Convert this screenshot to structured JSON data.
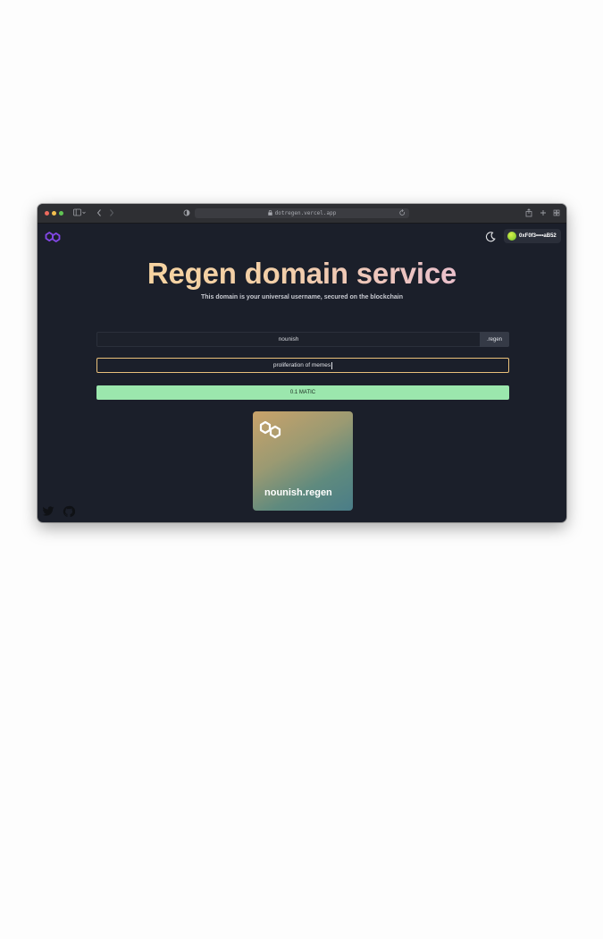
{
  "browser": {
    "url": "dotregen.vercel.app"
  },
  "header": {
    "wallet_address": "0xF0f3••••aB52"
  },
  "hero": {
    "title": "Regen domain service",
    "subtitle": "This domain is your universal username, secured on the blockchain"
  },
  "form": {
    "domain_value": "nounish",
    "tld_label": ".regen",
    "record_value": "proliferation of memes",
    "mint_button_label": "0.1 MATIC"
  },
  "card": {
    "domain_name": "nounish.regen"
  },
  "colors": {
    "background": "#1b1f2a",
    "accent_green": "#9be7ad",
    "input_focus_border": "#e9c07a",
    "logo_purple": "#8247e5"
  },
  "icons": [
    "polygon-logo-icon",
    "moon-icon",
    "wallet-avatar-icon",
    "twitter-icon",
    "github-icon",
    "lock-icon",
    "reload-icon",
    "shield-icon",
    "sidebar-icon",
    "share-icon",
    "plus-icon",
    "tabs-icon"
  ]
}
